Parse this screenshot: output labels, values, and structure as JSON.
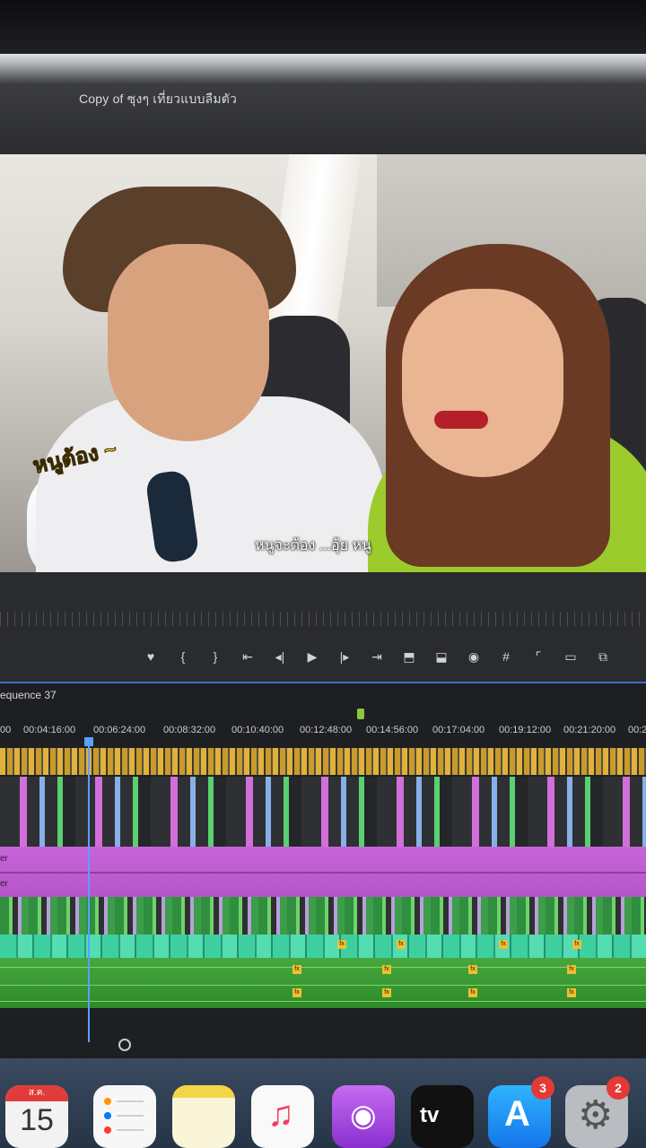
{
  "window": {
    "title": "Copy of ซุงๆ เที่ยวแบบลืมตัว"
  },
  "video": {
    "caption_left": "หนูต้อง ~",
    "caption_bottom": "หนูจะต้อง ...อุ้ย หนู"
  },
  "transport": {
    "buttons": [
      {
        "icon": "marker-icon",
        "glyph": "♥"
      },
      {
        "icon": "mark-in-icon",
        "glyph": "{"
      },
      {
        "icon": "mark-out-icon",
        "glyph": "}"
      },
      {
        "icon": "go-to-in-icon",
        "glyph": "⇤"
      },
      {
        "icon": "step-back-icon",
        "glyph": "◂|"
      },
      {
        "icon": "play-icon",
        "glyph": "▶"
      },
      {
        "icon": "step-forward-icon",
        "glyph": "|▸"
      },
      {
        "icon": "go-to-out-icon",
        "glyph": "⇥"
      },
      {
        "icon": "lift-icon",
        "glyph": "⬒"
      },
      {
        "icon": "extract-icon",
        "glyph": "⬓"
      },
      {
        "icon": "camera-icon",
        "glyph": "◉"
      },
      {
        "icon": "insert-icon",
        "glyph": "#"
      },
      {
        "icon": "overwrite-icon",
        "glyph": "⌜"
      },
      {
        "icon": "safe-margins-icon",
        "glyph": "▭"
      },
      {
        "icon": "compare-icon",
        "glyph": "⧉"
      }
    ]
  },
  "timeline": {
    "sequence_label": "equence 37",
    "timecodes": [
      "00",
      "00:04:16:00",
      "00:06:24:00",
      "00:08:32:00",
      "00:10:40:00",
      "00:12:48:00",
      "00:14:56:00",
      "00:17:04:00",
      "00:19:12:00",
      "00:21:20:00",
      "00:2"
    ],
    "track_labels": [
      "er",
      "er"
    ],
    "fx_label": "fx"
  },
  "dock": {
    "calendar": {
      "month": "ส.ค.",
      "day": "15"
    },
    "app_store_badge": "3",
    "system_prefs_badge": "2",
    "tv_label": "tv"
  },
  "colors": {
    "accent_blue": "#3c6ec8",
    "clip_pink": "#c765d8",
    "clip_gold": "#e0b23a",
    "clip_teal": "#3ecfa0",
    "clip_green": "#46a83c"
  }
}
